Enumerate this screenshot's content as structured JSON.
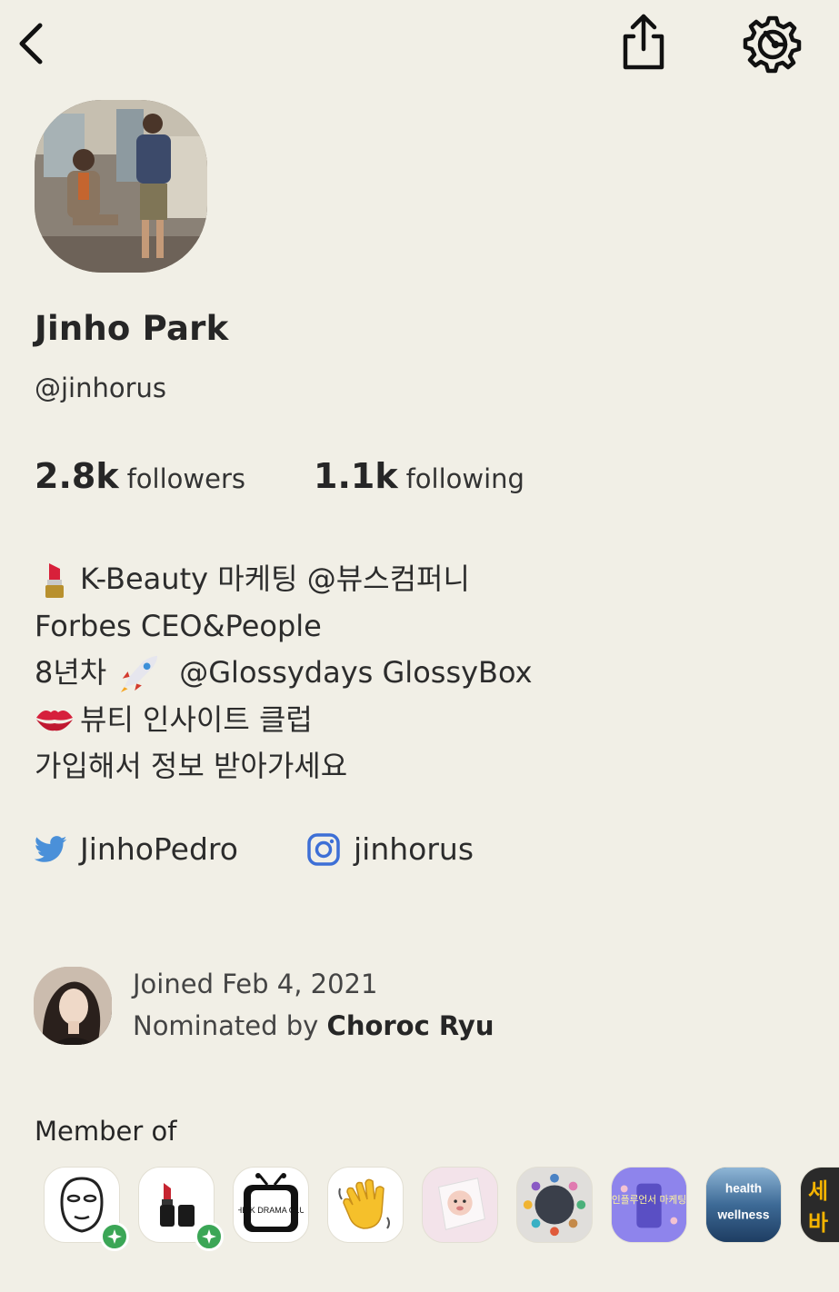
{
  "profile": {
    "name": "Jinho Park",
    "handle": "@jinhorus",
    "followers": {
      "count": "2.8k",
      "label": "followers"
    },
    "following": {
      "count": "1.1k",
      "label": "following"
    }
  },
  "bio": {
    "line1": "K-Beauty 마케팅 @뷰스컴퍼니",
    "line2": "Forbes CEO&People",
    "line3a": "8년차",
    "line3b": "@Glossydays GlossyBox",
    "line4": "뷰티 인사이트 클럽",
    "line5": "가입해서 정보 받아가세요",
    "emoji_line1": "lipstick-emoji",
    "emoji_line3": "rocket-emoji",
    "emoji_line4": "kiss-mark-emoji"
  },
  "social": {
    "twitter": "JinhoPedro",
    "instagram": "jinhorus"
  },
  "joined": {
    "joined_text": "Joined Feb 4, 2021",
    "nominated_prefix": "Nominated by",
    "nominated_by": "Choroc Ryu"
  },
  "member_of": {
    "title": "Member of",
    "club_icons": [
      "face-mask-club-icon",
      "lipstick-club-icon",
      "kdrama-club-icon",
      "waving-hand-club-icon",
      "baby-photo-club-icon",
      "meeting-table-club-icon",
      "influencer-marketing-club-icon",
      "health-wellness-club-icon",
      "korean-text-club-icon"
    ],
    "kdrama_text": "THE K DRAMA CLUB",
    "influencer_text": "인플루언서 마케팅",
    "health_top": "health",
    "health_bottom": "wellness",
    "partial_text": "세바"
  },
  "icons": {
    "back": "back-chevron-icon",
    "share": "share-icon",
    "settings": "settings-gear-icon"
  },
  "colors": {
    "background": "#f1efe6",
    "twitter": "#4a90d9",
    "instagram": "#3d6fd6",
    "badge": "#3ba656"
  }
}
